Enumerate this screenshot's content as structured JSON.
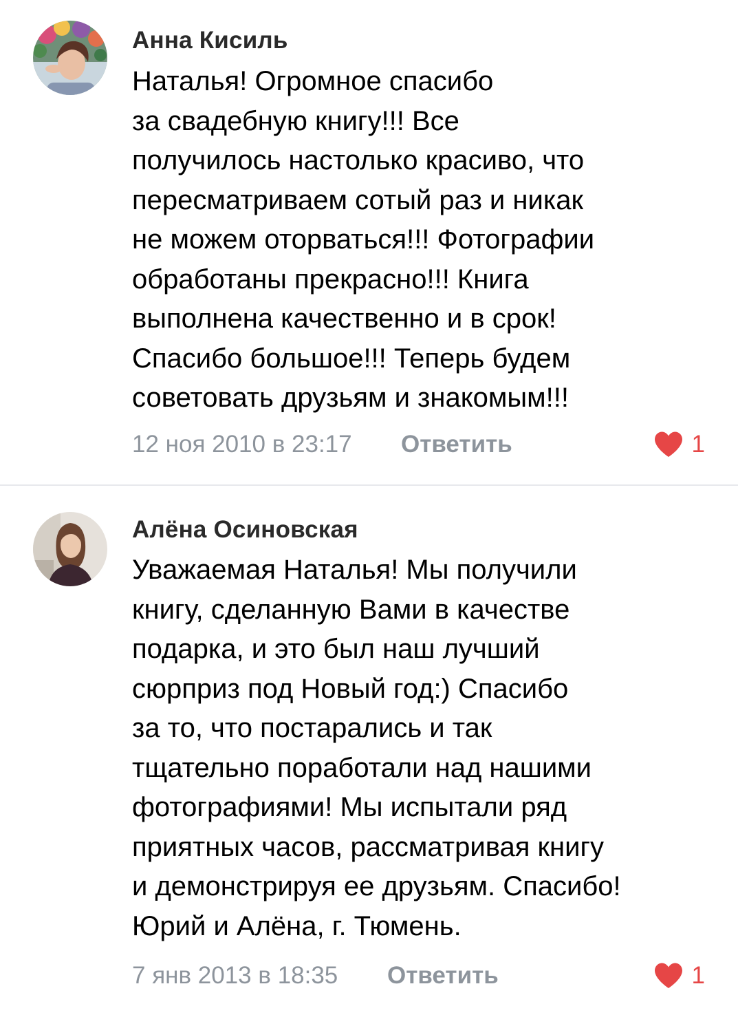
{
  "comments": [
    {
      "author": "Анна Кисиль",
      "text_lines": [
        "Наталья! Огромное спасибо",
        "за свадебную книгу!!! Все",
        "получилось настолько красиво, что",
        "пересматриваем сотый раз и никак",
        "не можем оторваться!!! Фотографии",
        "обработаны прекрасно!!! Книга",
        "выполнена качественно и в срок!",
        "Спасибо большое!!! Теперь будем",
        "советовать друзьям и знакомым!!!"
      ],
      "date": "12 ноя 2010 в 23:17",
      "reply_label": "Ответить",
      "likes": "1",
      "avatar_icon": "avatar-flower-wreath"
    },
    {
      "author": "Алёна Осиновская",
      "text_lines": [
        "Уважаемая Наталья! Мы получили",
        "книгу, сделанную Вами в качестве",
        "подарка, и это был наш лучший",
        "сюрприз под Новый год:) Спасибо",
        "за то, что постарались и так",
        "тщательно поработали над нашими",
        "фотографиями! Мы испытали ряд",
        "приятных часов, рассматривая книгу",
        "и демонстрируя ее друзьям. Спасибо!",
        "Юрий и Алёна, г. Тюмень."
      ],
      "date": "7 янв 2013 в 18:35",
      "reply_label": "Ответить",
      "likes": "1",
      "avatar_icon": "avatar-woman-portrait"
    }
  ],
  "colors": {
    "like_red": "#e64646",
    "meta_gray": "#8d949c",
    "divider": "#e7e8ec"
  }
}
